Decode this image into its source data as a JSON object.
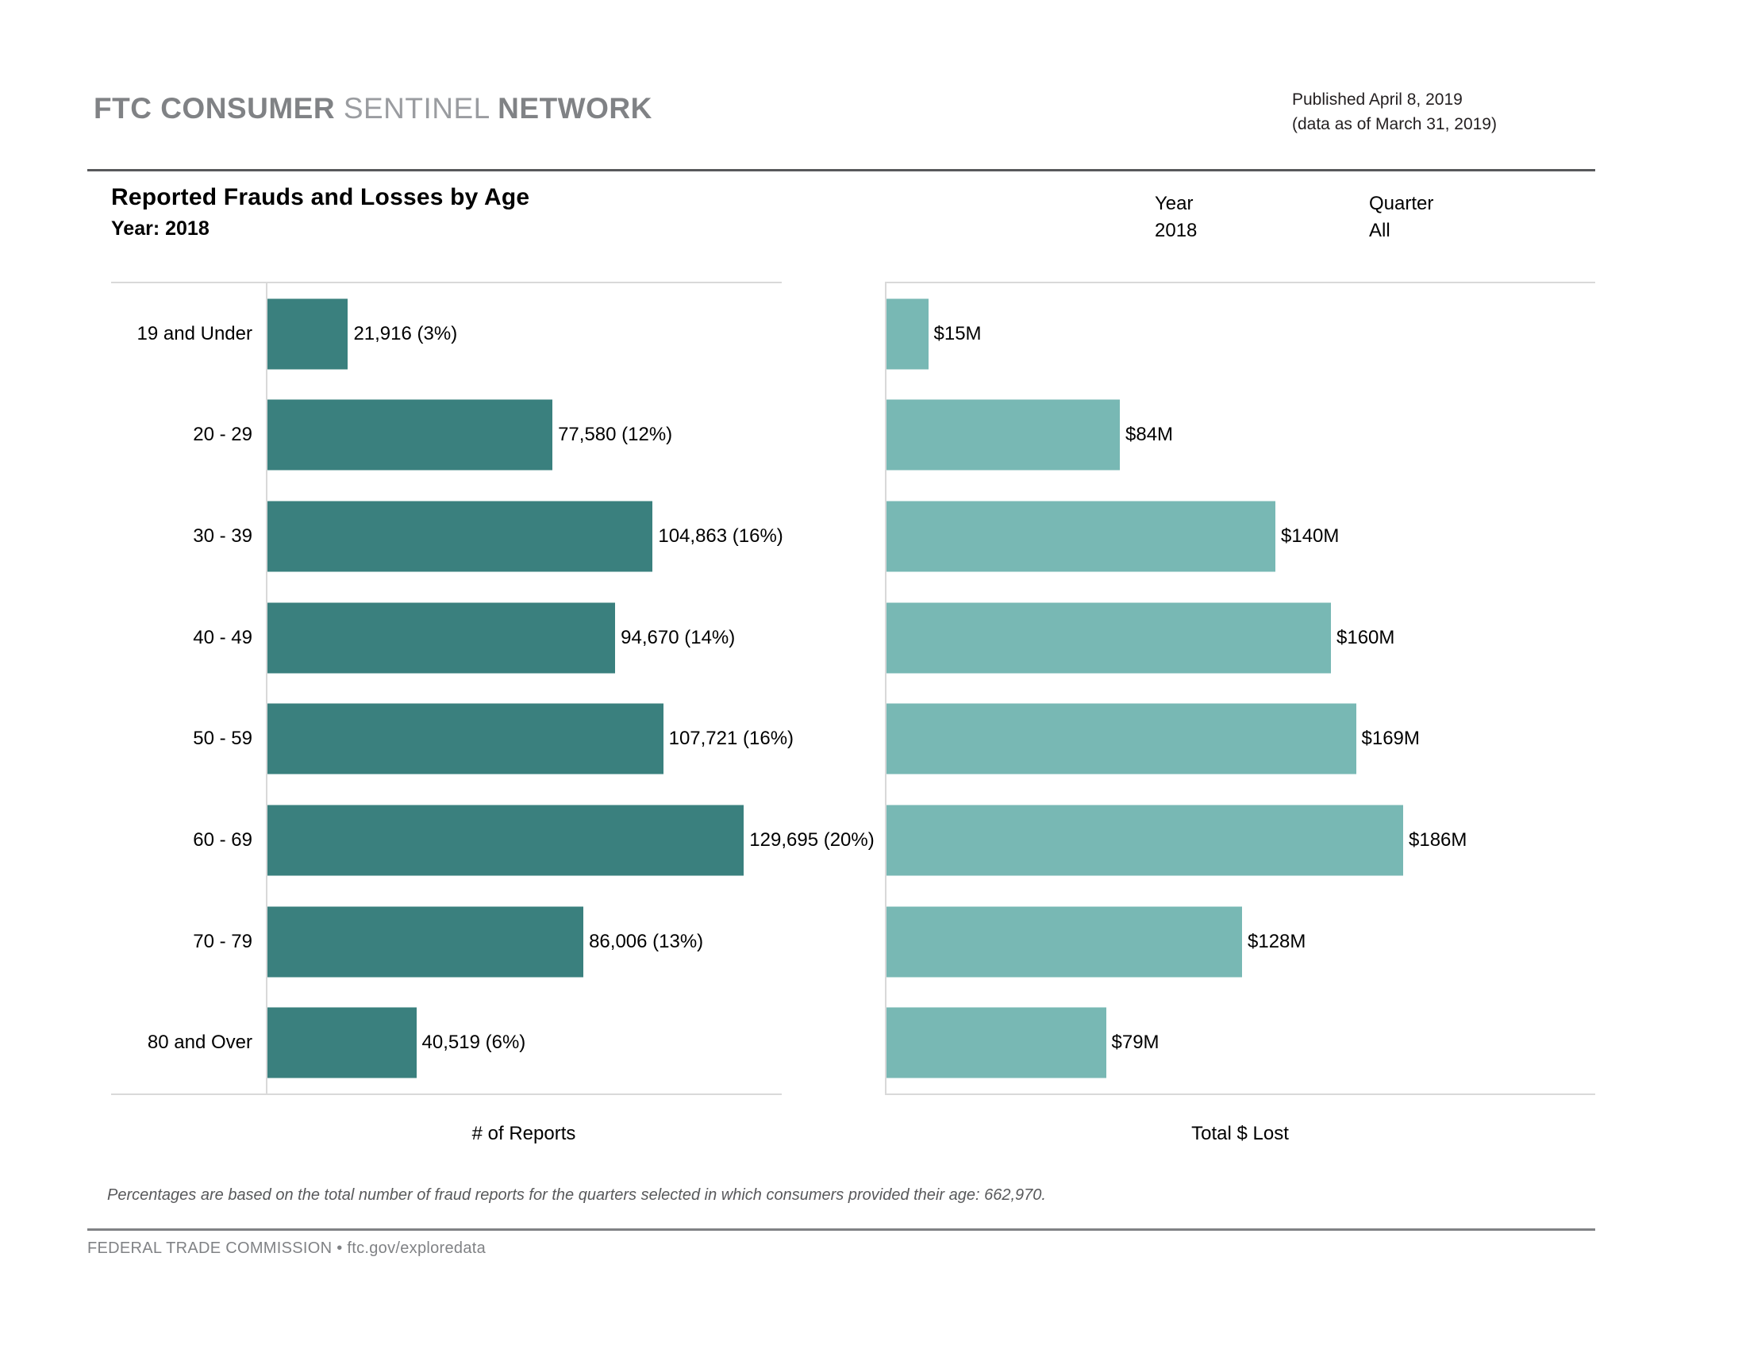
{
  "header": {
    "brand_part1": "FTC CONSUMER",
    "brand_part2": "SENTINEL",
    "brand_part3": "NETWORK",
    "published": "Published April 8, 2019",
    "data_as_of": "(data as of March 31, 2019)"
  },
  "title": {
    "main": "Reported Frauds and Losses by Age",
    "sub": "Year: 2018"
  },
  "filters": {
    "year_label": "Year",
    "year_value": "2018",
    "quarter_label": "Quarter",
    "quarter_value": "All"
  },
  "footnote": "Percentages are based on the total number of fraud reports for the quarters selected in which consumers provided their age: 662,970.",
  "footer": "FEDERAL TRADE COMMISSION • ftc.gov/exploredata",
  "colors": {
    "reports_bar": "#3a807e",
    "losses_bar": "#78b8b4",
    "brand_gray": "#808285",
    "rule_dark": "#58595b",
    "gridline": "#d9d9d9"
  },
  "chart_data": {
    "type": "bar",
    "orientation": "horizontal",
    "title": "Reported Frauds and Losses by Age",
    "subtitle": "Year: 2018",
    "categories": [
      "19 and Under",
      "20 - 29",
      "30 - 39",
      "40 - 49",
      "50 - 59",
      "60 - 69",
      "70 - 79",
      "80 and Over"
    ],
    "panels": [
      {
        "name": "reports",
        "xlabel": "# of Reports",
        "xlim": [
          0,
          140000
        ],
        "grid": false,
        "values": [
          21916,
          77580,
          104863,
          94670,
          107721,
          129695,
          86006,
          40519
        ],
        "percents": [
          3,
          12,
          16,
          14,
          16,
          20,
          13,
          6
        ],
        "labels": [
          "21,916 (3%)",
          "77,580 (12%)",
          "104,863 (16%)",
          "94,670 (14%)",
          "107,721 (16%)",
          "129,695 (20%)",
          "86,006 (13%)",
          "40,519 (6%)"
        ]
      },
      {
        "name": "losses",
        "xlabel": "Total $ Lost",
        "xlim": [
          0,
          200
        ],
        "grid": false,
        "unit": "millions of dollars",
        "values": [
          15,
          84,
          140,
          160,
          169,
          186,
          128,
          79
        ],
        "labels": [
          "$15M",
          "$84M",
          "$140M",
          "$160M",
          "$169M",
          "$186M",
          "$128M",
          "$79M"
        ]
      }
    ],
    "total_reports_with_age": 662970
  }
}
